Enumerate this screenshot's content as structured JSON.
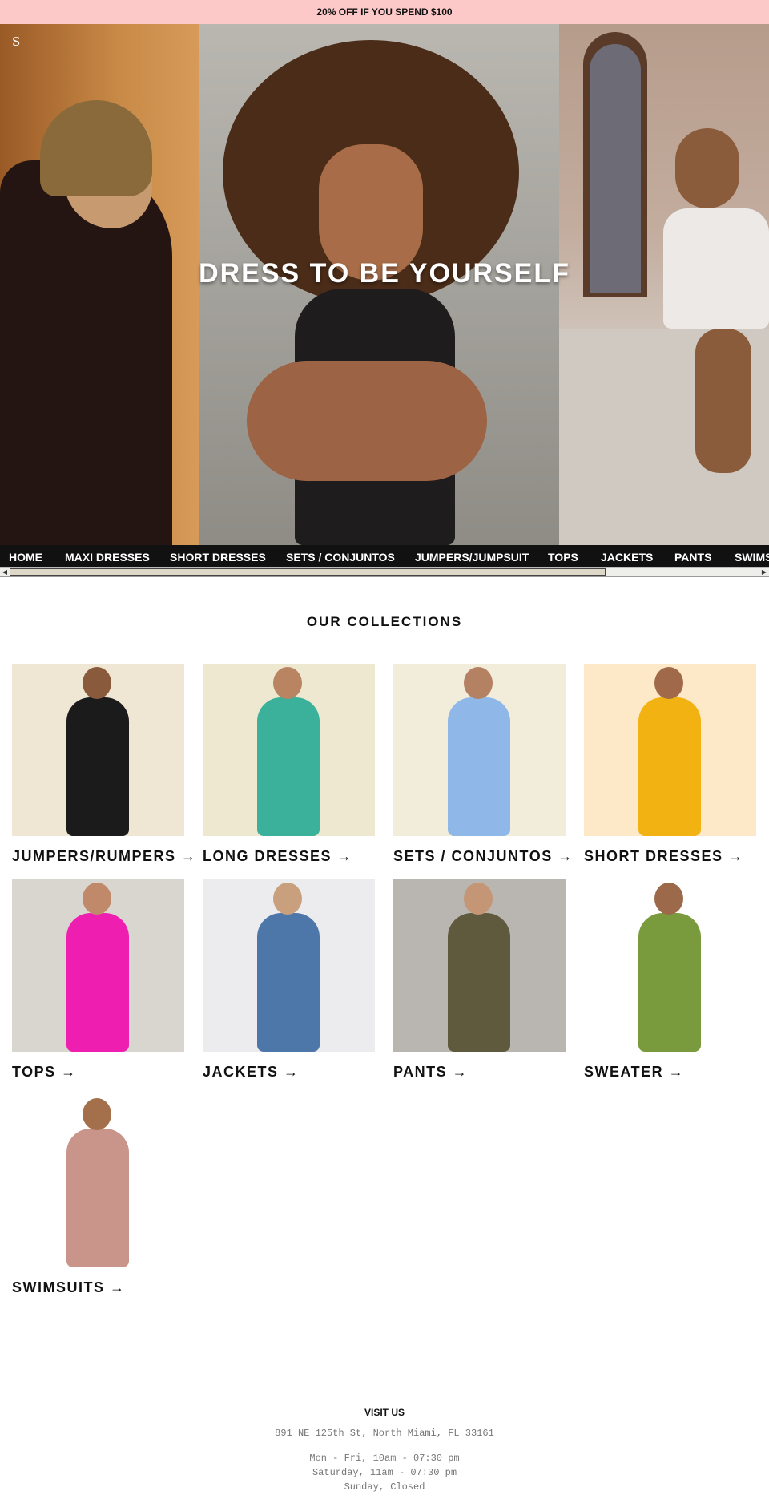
{
  "promo": {
    "text": "20% OFF IF YOU SPEND $100"
  },
  "header": {
    "logo": "S"
  },
  "hero": {
    "title": "DRESS TO BE YOURSELF"
  },
  "nav": {
    "items": [
      "HOME",
      "MAXI DRESSES",
      "SHORT DRESSES",
      "SETS / CONJUNTOS",
      "JUMPERS/JUMPSUIT",
      "TOPS",
      "JACKETS",
      "PANTS",
      "SWIMS"
    ]
  },
  "collections": {
    "title": "OUR COLLECTIONS",
    "items": [
      {
        "label": "JUMPERS/RUMPERS →",
        "colors": {
          "bg": "#efe7d3",
          "figure": "#1b1b1b",
          "skin": "#8a5a3d"
        }
      },
      {
        "label": "LONG DRESSES →",
        "colors": {
          "bg": "#efe8d0",
          "figure": "#3bb09a",
          "skin": "#b98462"
        }
      },
      {
        "label": "SETS / CONJUNTOS →",
        "colors": {
          "bg": "#f2ecdb",
          "figure": "#8fb7e8",
          "skin": "#b58163"
        }
      },
      {
        "label": "SHORT DRESSES →",
        "colors": {
          "bg": "#fde8c8",
          "figure": "#f2b312",
          "skin": "#a06a4a"
        }
      },
      {
        "label": "TOPS →",
        "colors": {
          "bg": "#d9d6cf",
          "figure": "#ee1fb0",
          "skin": "#c08a6a"
        }
      },
      {
        "label": "JACKETS →",
        "colors": {
          "bg": "#ecebee",
          "figure": "#4d77a8",
          "skin": "#c9a07e"
        }
      },
      {
        "label": "PANTS →",
        "colors": {
          "bg": "#b9b5b1",
          "figure": "#5f5a3e",
          "skin": "#c49676"
        }
      },
      {
        "label": "SWEATER →",
        "colors": {
          "bg": "#ffffff",
          "figure": "#7a9a3e",
          "skin": "#9c6a4a"
        }
      },
      {
        "label": "SWIMSUITS →",
        "colors": {
          "bg": "#ffffff",
          "figure": "#c9948a",
          "skin": "#a4704c"
        }
      }
    ]
  },
  "footer": {
    "heading": "VISIT US",
    "address": "891 NE 125th St, North Miami, FL 33161",
    "hours": [
      "Mon - Fri, 10am - 07:30 pm",
      "Saturday, 11am - 07:30 pm",
      "Sunday, Closed"
    ]
  }
}
